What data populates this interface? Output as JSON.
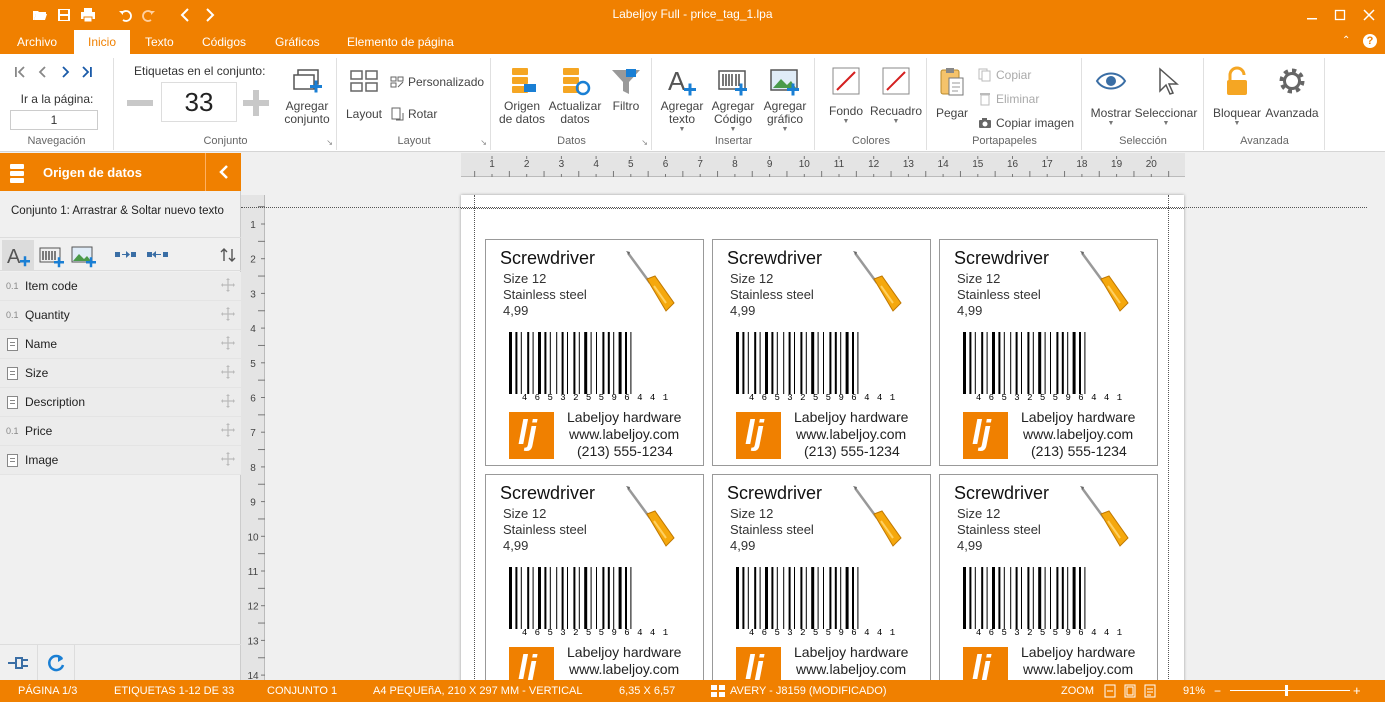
{
  "window": {
    "title": "Labeljoy Full - price_tag_1.lpa"
  },
  "colors": {
    "accent": "#f08000",
    "accent_text": "#ffffff"
  },
  "quick_access": [
    "folder-open-icon",
    "save-icon",
    "print-icon",
    "undo-icon",
    "redo-icon",
    "back-icon",
    "forward-icon"
  ],
  "tabs": [
    {
      "label": "Archivo"
    },
    {
      "label": "Inicio"
    },
    {
      "label": "Texto"
    },
    {
      "label": "Códigos"
    },
    {
      "label": "Gráficos"
    },
    {
      "label": "Elemento de página"
    }
  ],
  "ribbon": {
    "navegacion": {
      "label": "Navegación",
      "go_to_page": "Ir a la página:",
      "page_value": "1"
    },
    "conjunto": {
      "label": "Conjunto",
      "count_label": "Etiquetas en el conjunto:",
      "count": "33",
      "add_line1": "Agregar",
      "add_line2": "conjunto"
    },
    "layout": {
      "label": "Layout",
      "layout_btn": "Layout",
      "personalizado": "Personalizado",
      "rotar": "Rotar"
    },
    "datos": {
      "label": "Datos",
      "origen_1": "Origen",
      "origen_2": "de datos",
      "actualizar_1": "Actualizar",
      "actualizar_2": "datos",
      "filtro": "Filtro"
    },
    "insertar": {
      "label": "Insertar",
      "texto_1": "Agregar",
      "texto_2": "texto",
      "codigo_1": "Agregar",
      "codigo_2": "Código",
      "grafico_1": "Agregar",
      "grafico_2": "gráfico"
    },
    "colores": {
      "label": "Colores",
      "fondo": "Fondo",
      "recuadro": "Recuadro"
    },
    "portapapeles": {
      "label": "Portapapeles",
      "pegar": "Pegar",
      "copiar": "Copiar",
      "eliminar": "Eliminar",
      "copiar_imagen": "Copiar imagen"
    },
    "seleccion": {
      "label": "Selección",
      "mostrar": "Mostrar",
      "seleccionar": "Seleccionar"
    },
    "avanzada": {
      "label": "Avanzada",
      "bloquear": "Bloquear",
      "avanzada": "Avanzada"
    }
  },
  "panel": {
    "title": "Origen de datos",
    "subtitle": "Conjunto 1: Arrastrar & Soltar nuevo texto",
    "fields": [
      {
        "type": "0.1",
        "label": "Item code"
      },
      {
        "type": "0.1",
        "label": "Quantity"
      },
      {
        "type": "doc",
        "label": "Name"
      },
      {
        "type": "doc",
        "label": "Size"
      },
      {
        "type": "doc",
        "label": "Description"
      },
      {
        "type": "0.1",
        "label": "Price"
      },
      {
        "type": "doc",
        "label": "Image"
      }
    ]
  },
  "rulers": {
    "h_ticks": [
      "1",
      "2",
      "3",
      "4",
      "5",
      "6",
      "7",
      "8",
      "9",
      "10",
      "11",
      "12",
      "13",
      "14",
      "15",
      "16",
      "17",
      "18",
      "19",
      "20"
    ],
    "v_ticks": [
      "1",
      "2",
      "3",
      "4",
      "5",
      "6",
      "7",
      "8",
      "9",
      "10",
      "11",
      "12",
      "13",
      "14"
    ]
  },
  "label_template": {
    "name": "Screwdriver",
    "size": "Size 12",
    "description": "Stainless steel",
    "price": "4,99",
    "barcode_digits": "4 6 5 3 2 5 5 9 6 4 4 1",
    "company": "Labeljoy hardware",
    "website": "www.labeljoy.com",
    "phone": "(213) 555-1234",
    "logo_text": "lj"
  },
  "status": {
    "pagina": "PÁGINA 1/3",
    "etiquetas": "ETIQUETAS 1-12 DE 33",
    "conjunto": "CONJUNTO 1",
    "paper": "A4 PEQUEñA, 210 X 297 MM - VERTICAL",
    "size": "6,35 X 6,57",
    "avery": "AVERY - J8159 (MODIFICADO)",
    "zoom_label": "ZOOM",
    "zoom_value": "91%"
  }
}
